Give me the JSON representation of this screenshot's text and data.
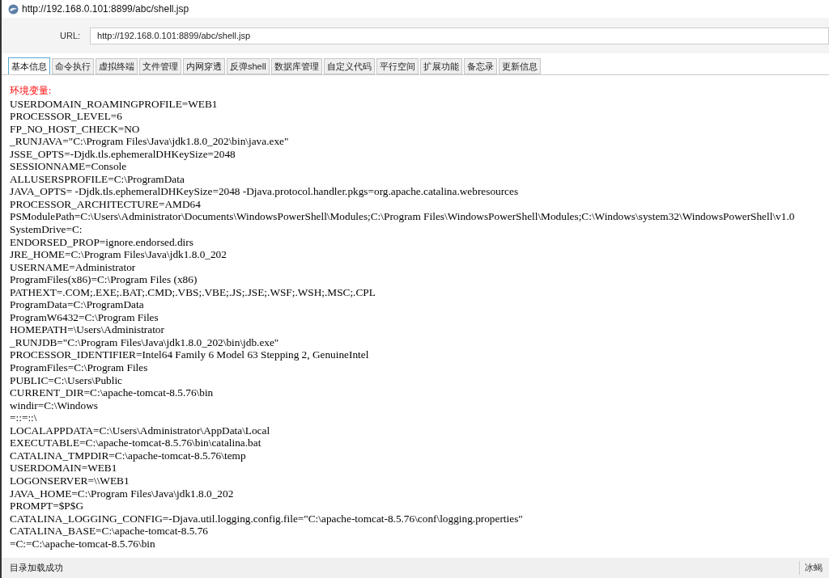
{
  "window": {
    "title": "http://192.168.0.101:8899/abc/shell.jsp"
  },
  "url_bar": {
    "label": "URL:",
    "value": "http://192.168.0.101:8899/abc/shell.jsp"
  },
  "tabs": [
    {
      "label": "基本信息",
      "selected": true
    },
    {
      "label": "命令执行",
      "selected": false
    },
    {
      "label": "虚拟终端",
      "selected": false
    },
    {
      "label": "文件管理",
      "selected": false
    },
    {
      "label": "内网穿透",
      "selected": false
    },
    {
      "label": "反弹shell",
      "selected": false
    },
    {
      "label": "数据库管理",
      "selected": false
    },
    {
      "label": "自定义代码",
      "selected": false
    },
    {
      "label": "平行空间",
      "selected": false
    },
    {
      "label": "扩展功能",
      "selected": false
    },
    {
      "label": "备忘录",
      "selected": false
    },
    {
      "label": "更新信息",
      "selected": false
    }
  ],
  "content": {
    "heading": "环境变量:",
    "lines": [
      "USERDOMAIN_ROAMINGPROFILE=WEB1",
      "PROCESSOR_LEVEL=6",
      "FP_NO_HOST_CHECK=NO",
      "_RUNJAVA=\"C:\\Program Files\\Java\\jdk1.8.0_202\\bin\\java.exe\"",
      "JSSE_OPTS=-Djdk.tls.ephemeralDHKeySize=2048",
      "SESSIONNAME=Console",
      "ALLUSERSPROFILE=C:\\ProgramData",
      "JAVA_OPTS= -Djdk.tls.ephemeralDHKeySize=2048 -Djava.protocol.handler.pkgs=org.apache.catalina.webresources",
      "PROCESSOR_ARCHITECTURE=AMD64",
      "PSModulePath=C:\\Users\\Administrator\\Documents\\WindowsPowerShell\\Modules;C:\\Program Files\\WindowsPowerShell\\Modules;C:\\Windows\\system32\\WindowsPowerShell\\v1.0",
      "SystemDrive=C:",
      "ENDORSED_PROP=ignore.endorsed.dirs",
      "JRE_HOME=C:\\Program Files\\Java\\jdk1.8.0_202",
      "USERNAME=Administrator",
      "ProgramFiles(x86)=C:\\Program Files (x86)",
      "PATHEXT=.COM;.EXE;.BAT;.CMD;.VBS;.VBE;.JS;.JSE;.WSF;.WSH;.MSC;.CPL",
      "ProgramData=C:\\ProgramData",
      "ProgramW6432=C:\\Program Files",
      "HOMEPATH=\\Users\\Administrator",
      "_RUNJDB=\"C:\\Program Files\\Java\\jdk1.8.0_202\\bin\\jdb.exe\"",
      "PROCESSOR_IDENTIFIER=Intel64 Family 6 Model 63 Stepping 2, GenuineIntel",
      "ProgramFiles=C:\\Program Files",
      "PUBLIC=C:\\Users\\Public",
      "CURRENT_DIR=C:\\apache-tomcat-8.5.76\\bin",
      "windir=C:\\Windows",
      "=::=::\\",
      "LOCALAPPDATA=C:\\Users\\Administrator\\AppData\\Local",
      "EXECUTABLE=C:\\apache-tomcat-8.5.76\\bin\\catalina.bat",
      "CATALINA_TMPDIR=C:\\apache-tomcat-8.5.76\\temp",
      "USERDOMAIN=WEB1",
      "LOGONSERVER=\\\\WEB1",
      "JAVA_HOME=C:\\Program Files\\Java\\jdk1.8.0_202",
      "PROMPT=$P$G",
      "CATALINA_LOGGING_CONFIG=-Djava.util.logging.config.file=\"C:\\apache-tomcat-8.5.76\\conf\\logging.properties\"",
      "CATALINA_BASE=C:\\apache-tomcat-8.5.76",
      "=C:=C:\\apache-tomcat-8.5.76\\bin"
    ]
  },
  "status_bar": {
    "message": "目录加载成功",
    "app_name": "冰蝎"
  }
}
